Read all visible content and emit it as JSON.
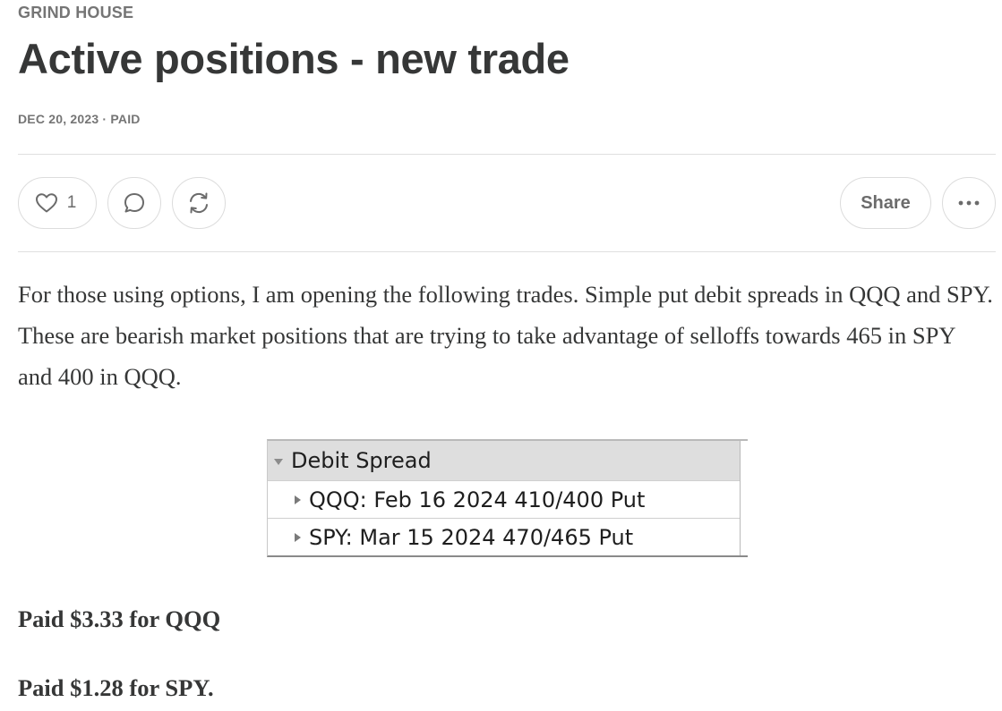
{
  "publication": "GRIND HOUSE",
  "post": {
    "title": "Active positions - new trade",
    "meta": "DEC 20, 2023 · PAID"
  },
  "actions": {
    "like_count": "1",
    "share_label": "Share",
    "like_icon": "heart-icon",
    "comment_icon": "comment-bubble-icon",
    "restack_icon": "restack-icon",
    "more_icon": "ellipsis-icon"
  },
  "body": {
    "paragraph": "For those using options, I am opening the following trades. Simple put debit spreads in QQQ and SPY. These are bearish market positions that are trying to take advantage of selloffs towards 465 in SPY and 400 in QQQ."
  },
  "positions_table": {
    "group_label": "Debit Spread",
    "rows": [
      "QQQ: Feb 16 2024 410/400 Put",
      "SPY: Mar 15 2024 470/465 Put"
    ]
  },
  "paid_lines": [
    "Paid $3.33 for QQQ",
    "Paid $1.28 for SPY."
  ],
  "colors": {
    "text": "#363737",
    "muted": "#757575",
    "border": "#dcdcdc",
    "table_header": "#dedede"
  }
}
